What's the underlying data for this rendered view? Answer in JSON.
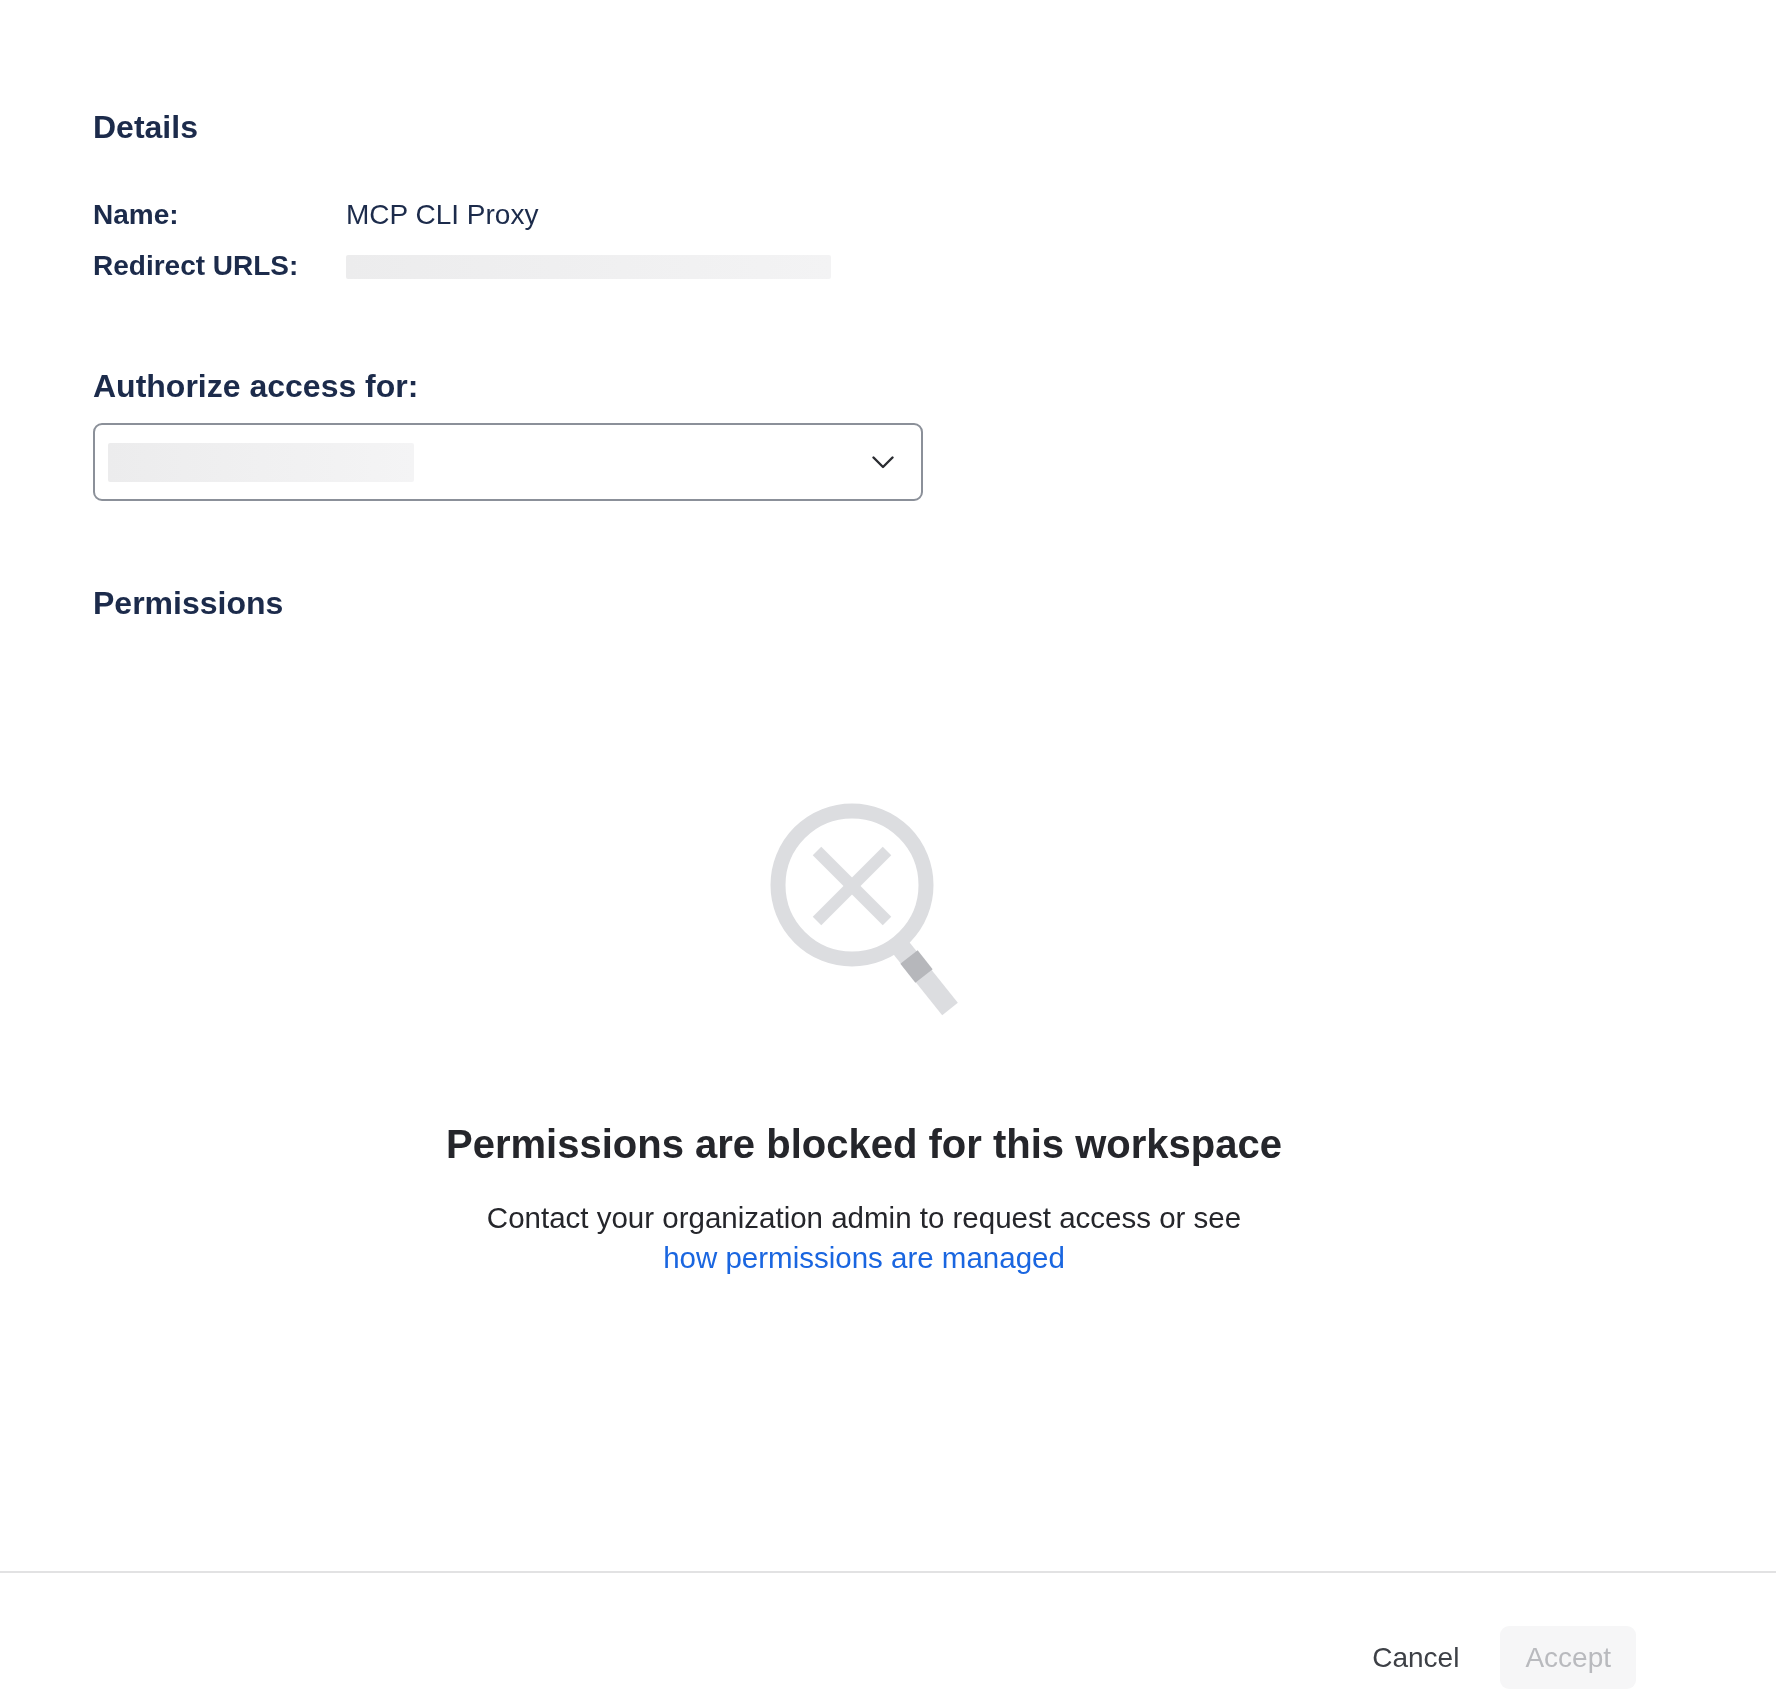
{
  "details": {
    "heading": "Details",
    "fields": [
      {
        "label": "Name:",
        "value": "MCP CLI Proxy"
      },
      {
        "label": "Redirect URLS:",
        "value_redacted": true
      }
    ]
  },
  "authorize": {
    "label": "Authorize access for:",
    "select": {
      "value_redacted": true
    }
  },
  "permissions": {
    "heading": "Permissions",
    "empty_state": {
      "title": "Permissions are blocked for this workspace",
      "message": "Contact your organization admin to request access or see",
      "link": "how permissions are managed"
    }
  },
  "footer": {
    "buttons": [
      {
        "label": "Cancel",
        "kind": "secondary",
        "disabled": false
      },
      {
        "label": "Accept",
        "kind": "primary",
        "disabled": true
      }
    ]
  }
}
